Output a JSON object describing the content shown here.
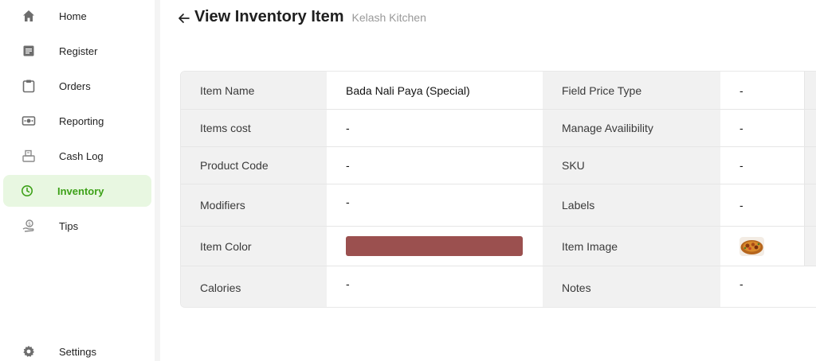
{
  "sidebar": {
    "items": [
      {
        "label": "Home",
        "icon": "home-icon"
      },
      {
        "label": "Register",
        "icon": "register-icon"
      },
      {
        "label": "Orders",
        "icon": "clipboard-icon"
      },
      {
        "label": "Reporting",
        "icon": "reporting-icon"
      },
      {
        "label": "Cash Log",
        "icon": "cash-register-icon"
      },
      {
        "label": "Inventory",
        "icon": "clock-icon",
        "active": true
      },
      {
        "label": "Tips",
        "icon": "tips-icon"
      },
      {
        "label": "Settings",
        "icon": "gear-icon"
      }
    ]
  },
  "header": {
    "title": "View Inventory Item",
    "subtitle": "Kelash Kitchen"
  },
  "details": {
    "rows": [
      {
        "label1": "Item Name",
        "value1": "Bada Nali Paya (Special)",
        "label2": "Field Price Type",
        "value2": "-"
      },
      {
        "label1": "Items cost",
        "value1": "-",
        "label2": "Manage Availibility",
        "value2": "-"
      },
      {
        "label1": "Product Code",
        "value1": "-",
        "label2": "SKU",
        "value2": "-"
      },
      {
        "label1": "Modifiers",
        "value1": "-",
        "label2": "Labels",
        "value2": "-"
      },
      {
        "label1": "Item Color",
        "value1": "",
        "label2": "Item Image",
        "value2": ""
      },
      {
        "label1": "Calories",
        "value1": "-",
        "label2": "Notes",
        "value2": "-"
      }
    ],
    "item_color": "#9b504f"
  },
  "colors": {
    "accent": "#3da118",
    "active_bg": "#e8f7e1"
  }
}
